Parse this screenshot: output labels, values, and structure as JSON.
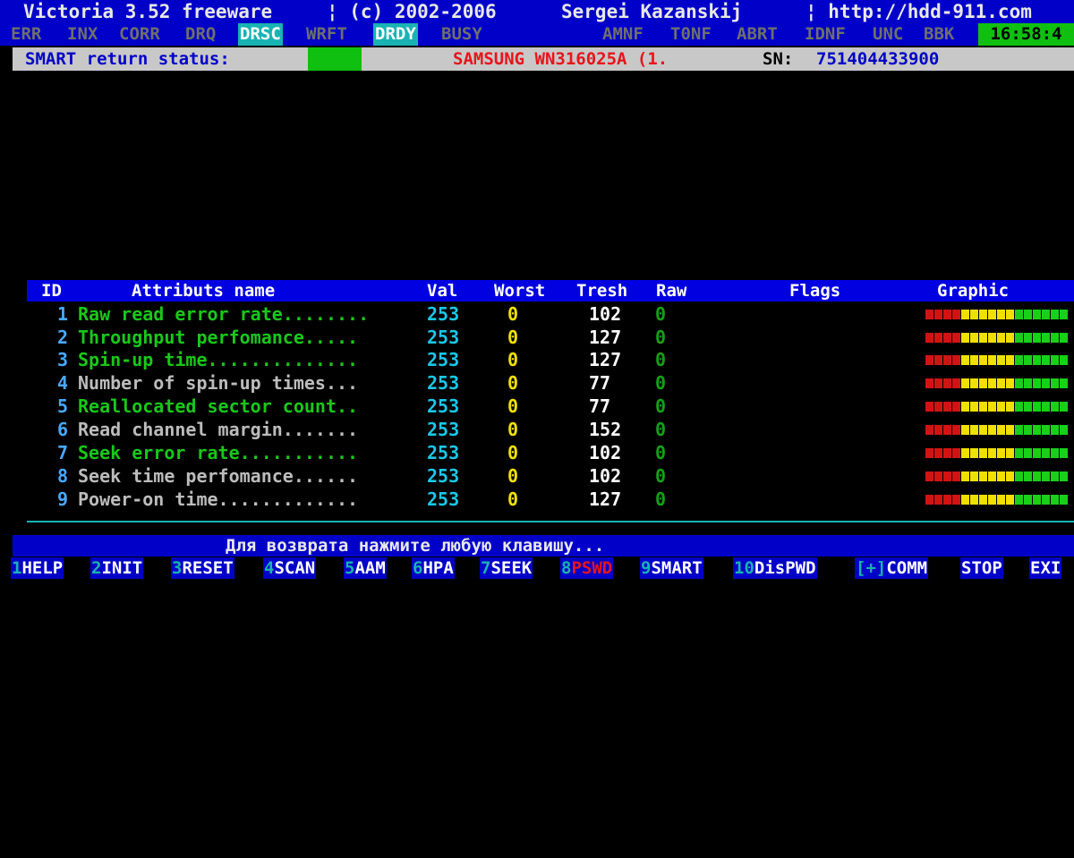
{
  "title": {
    "app": "Victoria 3.52 freeware",
    "copyright": "¦ (c) 2002-2006",
    "author": "Sergei Kazanskij",
    "url": "¦ http://hdd-911.com"
  },
  "status_flags": {
    "items": [
      {
        "label": "ERR",
        "active": false
      },
      {
        "label": "INX",
        "active": false
      },
      {
        "label": "CORR",
        "active": false
      },
      {
        "label": "DRQ",
        "active": false
      },
      {
        "label": "DRSC",
        "active": true
      },
      {
        "label": "WRFT",
        "active": false
      },
      {
        "label": "DRDY",
        "active": true
      },
      {
        "label": "BUSY",
        "active": false
      },
      {
        "label": "AMNF",
        "active": false
      },
      {
        "label": "T0NF",
        "active": false
      },
      {
        "label": "ABRT",
        "active": false
      },
      {
        "label": "IDNF",
        "active": false
      },
      {
        "label": "UNC",
        "active": false
      },
      {
        "label": "BBK",
        "active": false
      }
    ],
    "clock": "16:58:4"
  },
  "smart_status": {
    "label": "SMART return status:",
    "indicator_color": "#10c010",
    "drive_model": "SAMSUNG WN316025A (1.",
    "sn_label": "SN:",
    "sn_value": "751404433900"
  },
  "table": {
    "headers": {
      "id": "ID",
      "name": "Attributs name",
      "val": "Val",
      "worst": "Worst",
      "tresh": "Tresh",
      "raw": "Raw",
      "flags": "Flags",
      "graphic": "Graphic"
    },
    "rows": [
      {
        "id": "1",
        "name": "Raw read error rate........",
        "val": "253",
        "worst": "0",
        "tresh": "102",
        "raw": "0",
        "name_color": "#19c819"
      },
      {
        "id": "2",
        "name": "Throughput perfomance.....",
        "val": "253",
        "worst": "0",
        "tresh": "127",
        "raw": "0",
        "name_color": "#19c819"
      },
      {
        "id": "3",
        "name": "Spin-up time..............",
        "val": "253",
        "worst": "0",
        "tresh": "127",
        "raw": "0",
        "name_color": "#19c819"
      },
      {
        "id": "4",
        "name": "Number of spin-up times...",
        "val": "253",
        "worst": "0",
        "tresh": "77",
        "raw": "0",
        "name_color": "#bcbcbc"
      },
      {
        "id": "5",
        "name": "Reallocated sector count..",
        "val": "253",
        "worst": "0",
        "tresh": "77",
        "raw": "0",
        "name_color": "#19c819"
      },
      {
        "id": "6",
        "name": "Read channel margin.......",
        "val": "253",
        "worst": "0",
        "tresh": "152",
        "raw": "0",
        "name_color": "#bcbcbc"
      },
      {
        "id": "7",
        "name": "Seek error rate...........",
        "val": "253",
        "worst": "0",
        "tresh": "102",
        "raw": "0",
        "name_color": "#19c819"
      },
      {
        "id": "8",
        "name": "Seek time perfomance......",
        "val": "253",
        "worst": "0",
        "tresh": "102",
        "raw": "0",
        "name_color": "#bcbcbc"
      },
      {
        "id": "9",
        "name": "Power-on time.............",
        "val": "253",
        "worst": "0",
        "tresh": "127",
        "raw": "0",
        "name_color": "#bcbcbc"
      }
    ],
    "graphic_colors": [
      "#d01414",
      "#d01414",
      "#d01414",
      "#d01414",
      "#f0e000",
      "#f0e000",
      "#f0e000",
      "#f0e000",
      "#f0e000",
      "#f0e000",
      "#19d019",
      "#19d019",
      "#19d019",
      "#19d019",
      "#19d019",
      "#19d019"
    ]
  },
  "message": "Для возврата нажмите любую клавишу...",
  "function_keys": [
    {
      "num": "1",
      "label": "HELP"
    },
    {
      "num": "2",
      "label": "INIT"
    },
    {
      "num": "3",
      "label": "RESET"
    },
    {
      "num": "4",
      "label": "SCAN"
    },
    {
      "num": "5",
      "label": "AAM"
    },
    {
      "num": "6",
      "label": "HPA"
    },
    {
      "num": "7",
      "label": "SEEK"
    },
    {
      "num": "8",
      "label": "PSWD",
      "disabled": true
    },
    {
      "num": "9",
      "label": "SMART"
    },
    {
      "num": "10",
      "label": "DisPWD"
    },
    {
      "num": "[+]",
      "label": "COMM"
    },
    {
      "num": "",
      "label": "STOP"
    },
    {
      "num": "",
      "label": "EXI"
    }
  ]
}
